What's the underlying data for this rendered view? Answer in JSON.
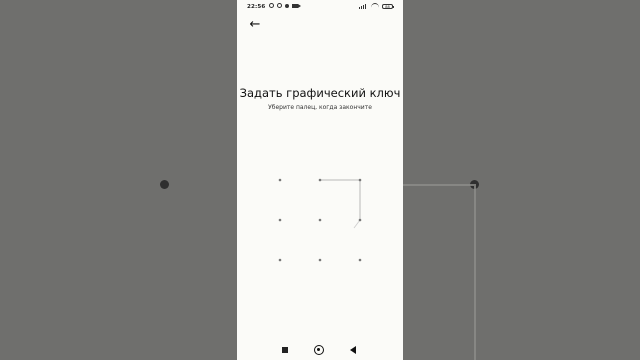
{
  "status_bar": {
    "time": "22:56",
    "battery": "88"
  },
  "header": {
    "back_icon": "left-arrow-icon"
  },
  "content": {
    "title": "Задать графический ключ",
    "subtitle": "Уберите палец, когда закончите"
  },
  "pattern": {
    "dot_count": 9,
    "selected_path": [
      "top-middle",
      "top-right",
      "middle-right"
    ]
  },
  "navigation": {
    "recents_icon": "square-icon",
    "home_icon": "circle-icon",
    "back_icon": "triangle-back-icon"
  },
  "colors": {
    "background": "#6f6f6d",
    "phone_surface": "#fbfbf8",
    "text": "#111111",
    "pattern_line": "#b8b8b8"
  }
}
